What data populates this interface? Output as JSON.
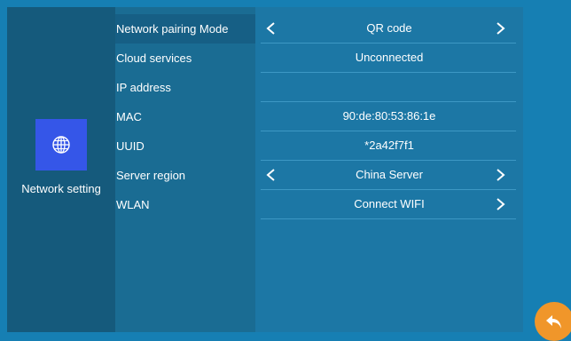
{
  "nav": {
    "label": "Network setting",
    "icon": "globe-icon"
  },
  "settings": {
    "rows": [
      {
        "label": "Network pairing Mode",
        "value": "QR code"
      },
      {
        "label": "Cloud services",
        "value": "Unconnected"
      },
      {
        "label": "IP address",
        "value": ""
      },
      {
        "label": "MAC",
        "value": "90:de:80:53:86:1e"
      },
      {
        "label": "UUID",
        "value": "*2a42f7f1"
      },
      {
        "label": "Server region",
        "value": "China Server"
      },
      {
        "label": "WLAN",
        "value": "Connect WIFI"
      }
    ]
  },
  "colors": {
    "background": "#167fb3",
    "nav_tile": "#3556e8",
    "back_button": "#f0962a"
  },
  "back_icon": "back-arrow-icon"
}
